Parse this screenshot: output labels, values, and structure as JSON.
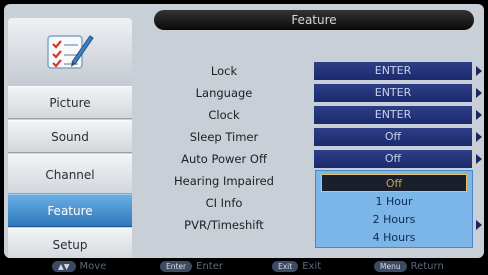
{
  "header": {
    "title": "Feature"
  },
  "sidebar": {
    "icon": "settings-checklist-icon",
    "items": [
      {
        "label": "Picture",
        "active": false
      },
      {
        "label": "Sound",
        "active": false
      },
      {
        "label": "Channel",
        "active": false
      },
      {
        "label": "Feature",
        "active": true
      },
      {
        "label": "Setup",
        "active": false
      }
    ]
  },
  "menu": {
    "rows": [
      {
        "label": "Lock",
        "value": "ENTER"
      },
      {
        "label": "Language",
        "value": "ENTER"
      },
      {
        "label": "Clock",
        "value": "ENTER"
      },
      {
        "label": "Sleep Timer",
        "value": "Off"
      },
      {
        "label": "Auto Power Off",
        "value": "Off"
      },
      {
        "label": "Hearing Impaired",
        "value": ""
      },
      {
        "label": "CI Info",
        "value": ""
      },
      {
        "label": "PVR/Timeshift",
        "value": ""
      }
    ]
  },
  "dropdown": {
    "options": [
      "Off",
      "1 Hour",
      "2 Hours",
      "4 Hours"
    ],
    "selected": "Off"
  },
  "footer": {
    "hints": [
      {
        "key": "▲▼",
        "label": "Move"
      },
      {
        "key": "Enter",
        "label": "Enter"
      },
      {
        "key": "Exit",
        "label": "Exit"
      },
      {
        "key": "Menu",
        "label": "Return"
      }
    ]
  },
  "colors": {
    "active_tab": "#3a88cc",
    "value_box": "#24337a",
    "dropdown_bg": "#7cb6e8",
    "selected_border": "#e6c060"
  }
}
